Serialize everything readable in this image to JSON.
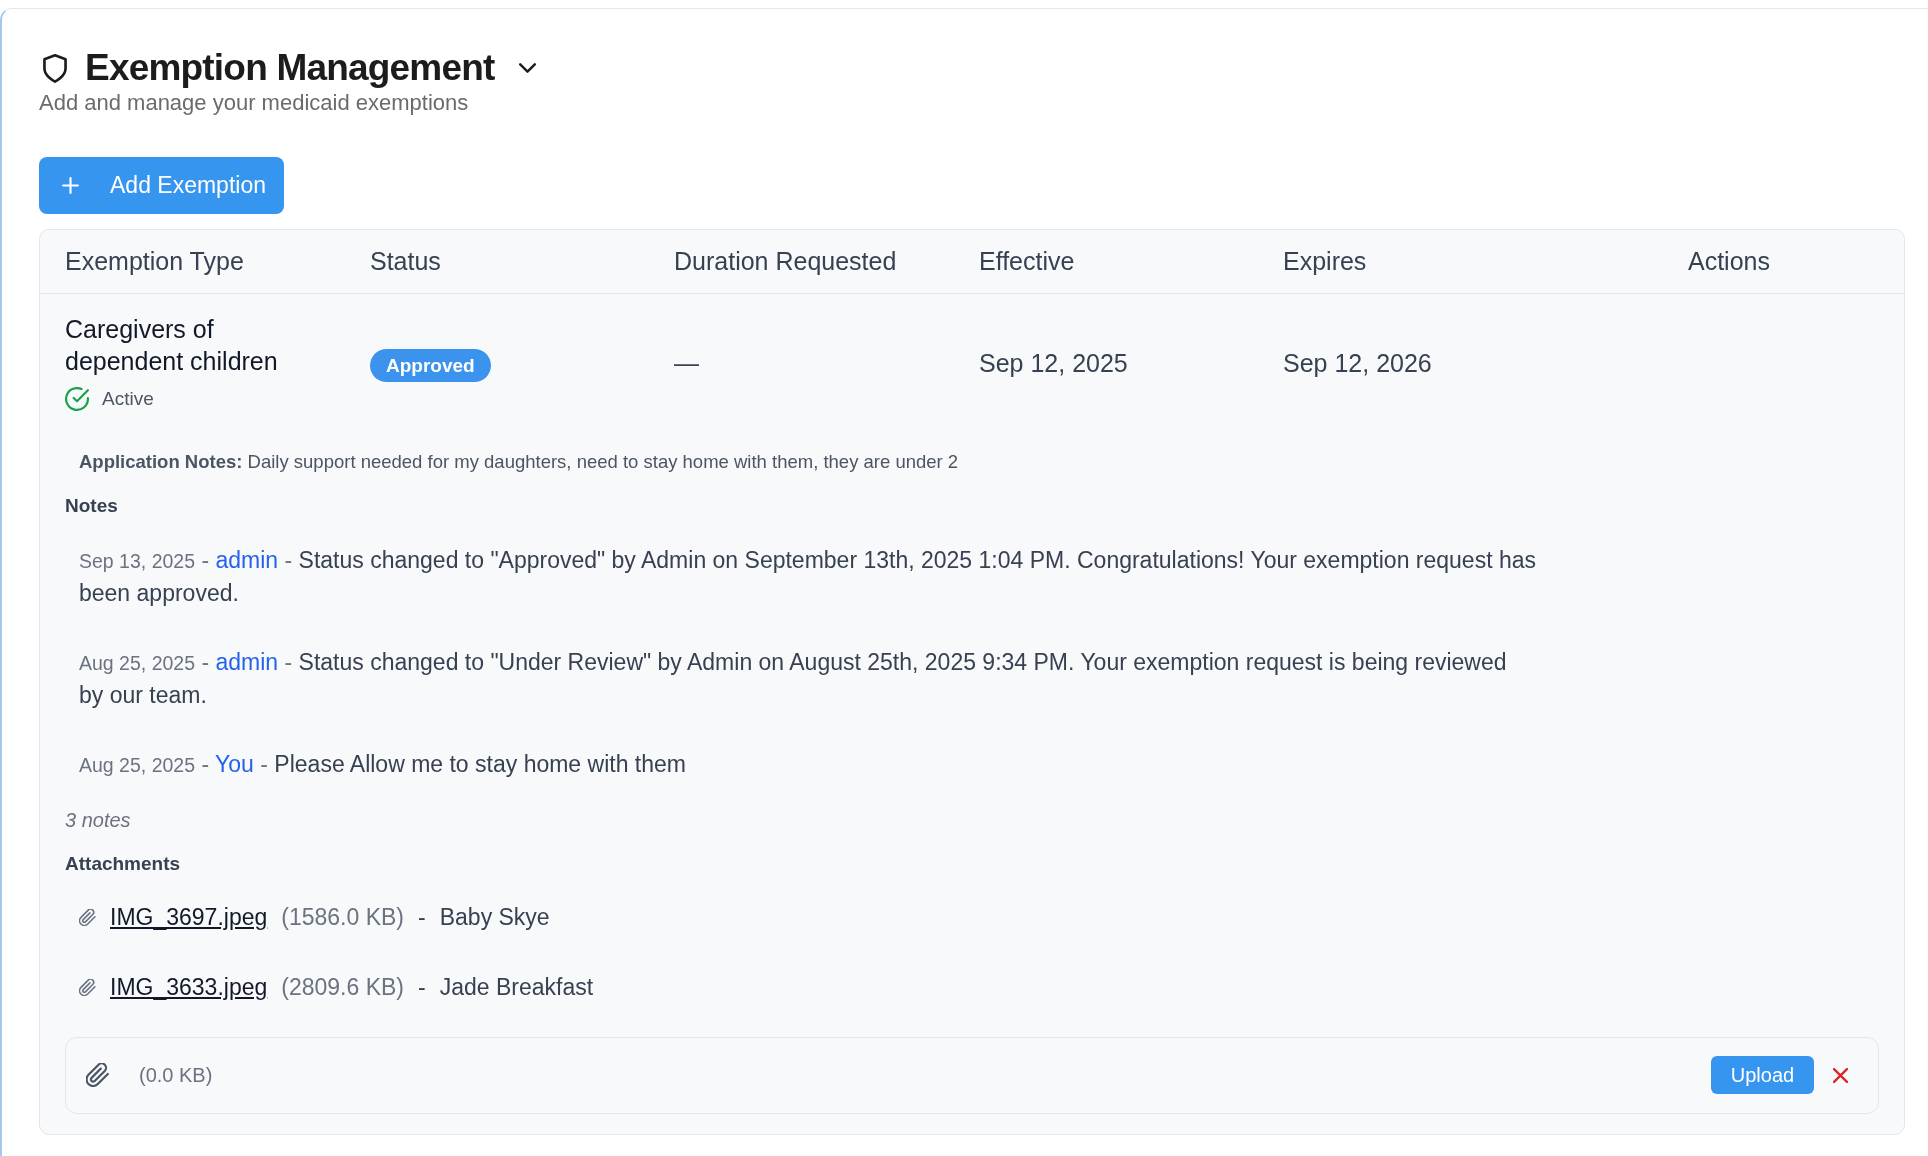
{
  "header": {
    "title": "Exemption Management",
    "subtitle": "Add and manage your medicaid exemptions"
  },
  "add_button": {
    "label": "Add Exemption"
  },
  "table": {
    "columns": [
      "Exemption Type",
      "Status",
      "Duration Requested",
      "Effective",
      "Expires",
      "Actions"
    ],
    "rows": [
      {
        "exemption_type": "Caregivers of dependent children",
        "state": "Active",
        "status": "Approved",
        "duration_requested": "—",
        "effective": "Sep 12, 2025",
        "expires": "Sep 12, 2026",
        "application_notes": "**Application Notes:** Daily support needed for my daughters, need to stay home with them, they are under 2",
        "notes_heading": "Notes",
        "notes": [
          {
            "date": "Sep 13, 2025",
            "separators": [
              "-",
              "-"
            ],
            "author": "admin",
            "message": "Status changed to \"Approved\" by Admin on September 13th, 2025 1:04 PM. Congratulations! Your exemption request has been approved."
          },
          {
            "date": "Aug 25, 2025",
            "separators": [
              "-",
              "-"
            ],
            "author": "admin",
            "message": "Status changed to \"Under Review\" by Admin on August 25th, 2025 9:34 PM. Your exemption request is being reviewed by our team."
          },
          {
            "date": "Aug 25, 2025",
            "separators": [
              "-",
              "-"
            ],
            "author": "You",
            "message": "Please Allow me to stay home with them"
          }
        ],
        "notes_count": "3 notes",
        "attachments_heading": "Attachments",
        "attachments": [
          {
            "file_name": "IMG_3697.jpeg",
            "size": "(1586.0 KB)",
            "separator": "-",
            "description": "Baby Skye"
          },
          {
            "file_name": "IMG_3633.jpeg",
            "size": "(2809.6 KB)",
            "separator": "-",
            "description": "Jade Breakfast"
          }
        ],
        "upload": {
          "size": "(0.0 KB)",
          "button": "Upload"
        }
      }
    ]
  }
}
